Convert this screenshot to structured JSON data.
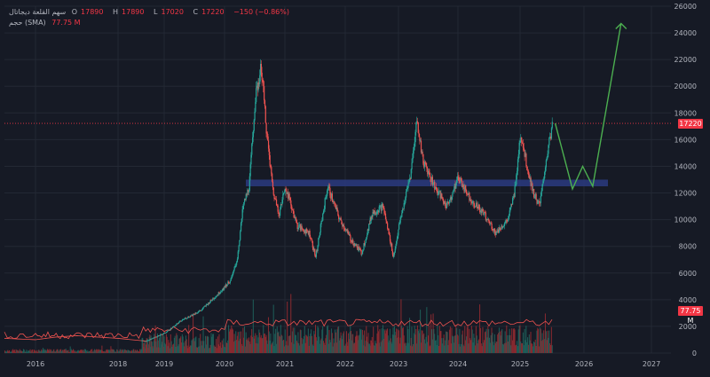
{
  "header": {
    "symbol": "سهم القلعة ديجاتال",
    "o_label": "O",
    "o_value": "17890",
    "h_label": "H",
    "h_value": "17890",
    "l_label": "L",
    "l_value": "17020",
    "c_label": "C",
    "c_value": "17220",
    "change": "−150 (−0.86%)",
    "volume_label": "حجم (SMA)",
    "volume_value": "77.75 M"
  },
  "price_tag": {
    "value": "17220",
    "color": "#f23645"
  },
  "volume_tag": {
    "value": "77.75 M",
    "color": "#f23645"
  },
  "colors": {
    "background": "#161a25",
    "up": "#26a69a",
    "down": "#ef5350",
    "zone": "#2a3b80",
    "arrow": "#4caf50",
    "volume_up": "#1e5e59",
    "volume_down": "#8a2a30"
  },
  "chart_data": {
    "type": "candlestick",
    "y_axis_ticks": [
      "26000",
      "24000",
      "22000",
      "20000",
      "18000",
      "16000",
      "14000",
      "12000",
      "10000",
      "8000",
      "6000",
      "4000",
      "2000",
      "0"
    ],
    "ylim": [
      0,
      26000
    ],
    "x_axis_ticks": [
      "2016",
      "2018",
      "2019",
      "2020",
      "2021",
      "2022",
      "2023",
      "2024",
      "2025",
      "2026",
      "2027"
    ],
    "last_close": 17220,
    "resistance_zone": [
      12500,
      13000
    ],
    "price_path": [
      [
        2015.5,
        1100
      ],
      [
        2016.0,
        1000
      ],
      [
        2016.5,
        1200
      ],
      [
        2017.0,
        1300
      ],
      [
        2017.5,
        1200
      ],
      [
        2018.0,
        1100
      ],
      [
        2018.3,
        1000
      ],
      [
        2018.6,
        900
      ],
      [
        2019.0,
        1500
      ],
      [
        2019.3,
        2500
      ],
      [
        2019.6,
        3200
      ],
      [
        2019.9,
        4500
      ],
      [
        2020.1,
        5500
      ],
      [
        2020.2,
        7000
      ],
      [
        2020.3,
        11000
      ],
      [
        2020.4,
        12500
      ],
      [
        2020.5,
        19000
      ],
      [
        2020.6,
        21500
      ],
      [
        2020.7,
        16000
      ],
      [
        2020.8,
        12000
      ],
      [
        2020.9,
        10500
      ],
      [
        2021.0,
        12500
      ],
      [
        2021.2,
        9500
      ],
      [
        2021.4,
        9000
      ],
      [
        2021.5,
        7200
      ],
      [
        2021.7,
        12500
      ],
      [
        2021.9,
        10000
      ],
      [
        2022.1,
        8500
      ],
      [
        2022.3,
        7500
      ],
      [
        2022.5,
        10500
      ],
      [
        2022.7,
        11000
      ],
      [
        2022.9,
        7200
      ],
      [
        2023.0,
        9500
      ],
      [
        2023.2,
        13500
      ],
      [
        2023.3,
        17500
      ],
      [
        2023.4,
        14500
      ],
      [
        2023.6,
        12500
      ],
      [
        2023.8,
        11000
      ],
      [
        2023.9,
        12000
      ],
      [
        2024.0,
        13200
      ],
      [
        2024.2,
        11500
      ],
      [
        2024.4,
        10500
      ],
      [
        2024.6,
        9000
      ],
      [
        2024.8,
        10000
      ],
      [
        2024.9,
        12000
      ],
      [
        2025.0,
        16500
      ],
      [
        2025.1,
        14000
      ],
      [
        2025.2,
        12000
      ],
      [
        2025.3,
        11000
      ],
      [
        2025.4,
        14500
      ],
      [
        2025.5,
        17220
      ]
    ],
    "projection": [
      [
        2025.55,
        17220
      ],
      [
        2025.82,
        12300
      ],
      [
        2025.98,
        14000
      ],
      [
        2026.13,
        12500
      ],
      [
        2026.55,
        24700
      ]
    ]
  }
}
